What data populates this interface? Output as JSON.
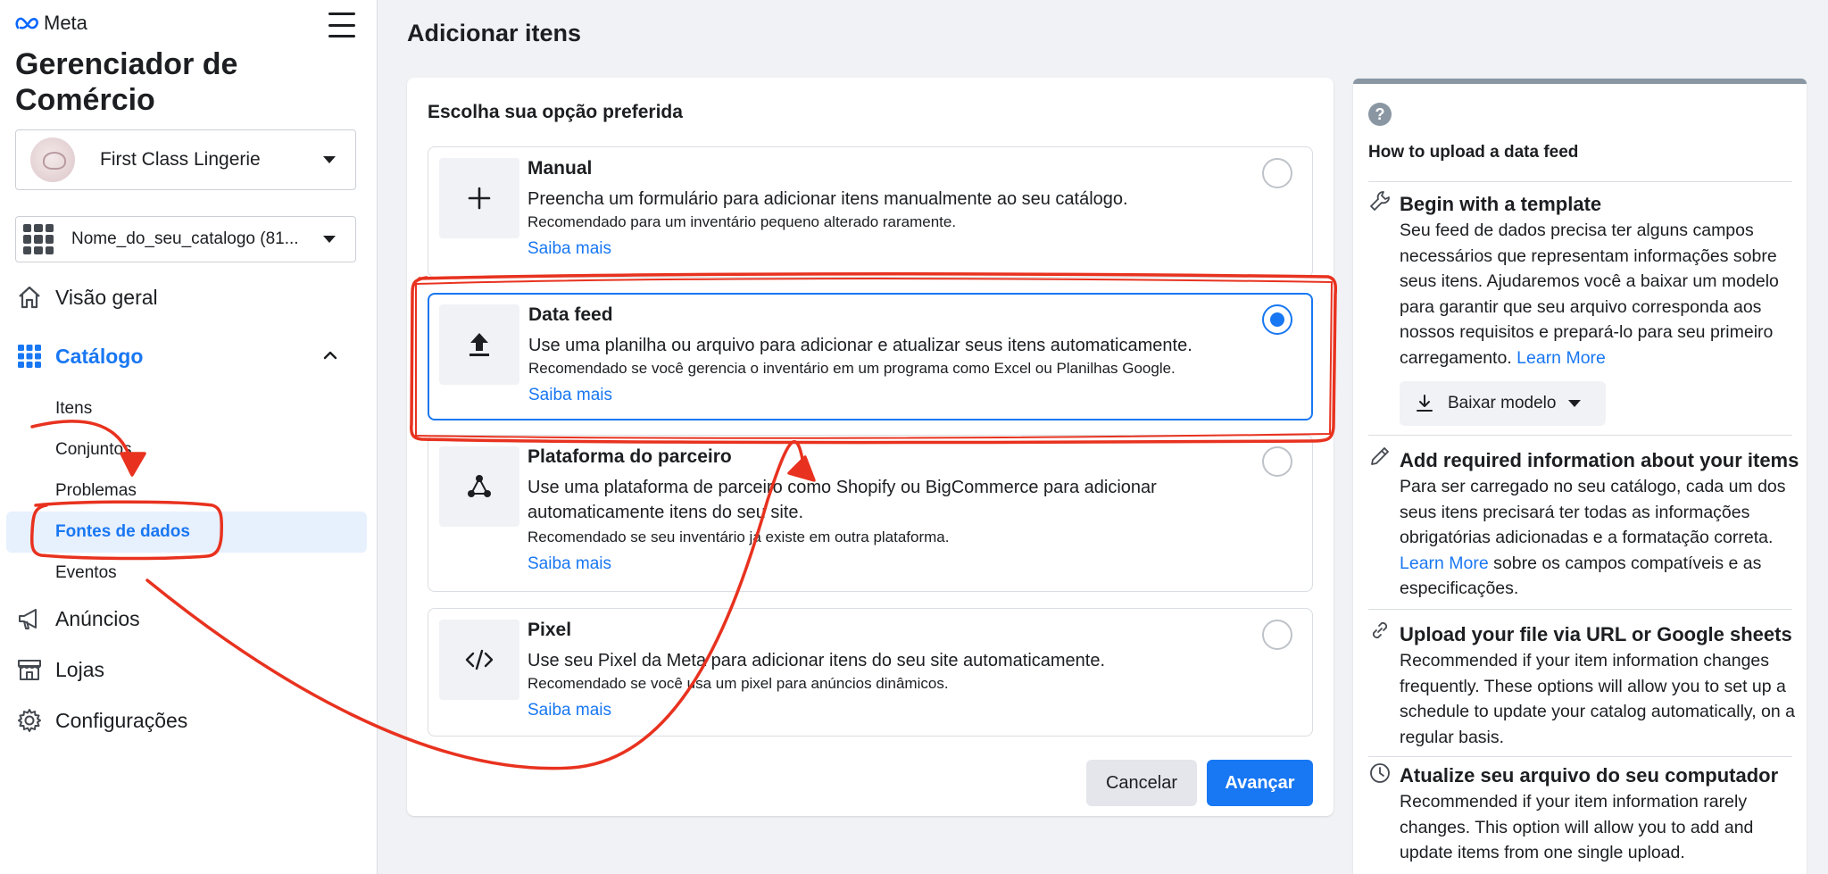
{
  "brand": {
    "name": "Meta",
    "accent": "#1877f2"
  },
  "sidebar": {
    "app_title": "Gerenciador de Comércio",
    "business": "First Class Lingerie",
    "catalog": "Nome_do_seu_catalogo (81...",
    "nav": {
      "overview": "Visão geral",
      "catalog": "Catálogo",
      "ads": "Anúncios",
      "shops": "Lojas",
      "settings": "Configurações"
    },
    "catalog_items": {
      "items": "Itens",
      "sets": "Conjuntos",
      "issues": "Problemas",
      "data_sources": "Fontes de dados",
      "events": "Eventos"
    }
  },
  "main": {
    "page_title": "Adicionar itens",
    "heading": "Escolha sua opção preferida",
    "options": [
      {
        "title": "Manual",
        "desc": "Preencha um formulário para adicionar itens manualmente ao seu catálogo.",
        "rec": "Recomendado para um inventário pequeno alterado raramente.",
        "link": "Saiba mais"
      },
      {
        "title": "Data feed",
        "desc": "Use uma planilha ou arquivo para adicionar e atualizar seus itens automaticamente.",
        "rec": "Recomendado se você gerencia o inventário em um programa como Excel ou Planilhas Google.",
        "link": "Saiba mais"
      },
      {
        "title": "Plataforma do parceiro",
        "desc": "Use uma plataforma de parceiro como Shopify ou BigCommerce para adicionar automaticamente itens do seu site.",
        "rec": "Recomendado se seu inventário já existe em outra plataforma.",
        "link": "Saiba mais"
      },
      {
        "title": "Pixel",
        "desc": "Use seu Pixel da Meta para adicionar itens do seu site automaticamente.",
        "rec": "Recomendado se você usa um pixel para anúncios dinâmicos.",
        "link": "Saiba mais"
      }
    ],
    "selected_option": "Data feed",
    "cancel": "Cancelar",
    "next": "Avançar"
  },
  "help": {
    "q_mark": "?",
    "title": "How to upload a data feed",
    "sections": [
      {
        "title": "Begin with a template",
        "body": "Seu feed de dados precisa ter alguns campos necessários que representam informações sobre seus itens. Ajudaremos você a baixar um modelo para garantir que seu arquivo corresponda aos nossos requisitos e prepará-lo para seu primeiro carregamento.",
        "link": "Learn More"
      },
      {
        "title": "Add required information about your items",
        "body": "Para ser carregado no seu catálogo, cada um dos seus itens precisará ter todas as informações obrigatórias adicionadas e a formatação correta.",
        "link": "Learn More",
        "body_after": "sobre os campos compatíveis e as especificações."
      },
      {
        "title": "Upload your file via URL or Google sheets",
        "body": "Recommended if your item information changes frequently. These options will allow you to set up a schedule to update your catalog automatically, on a regular basis."
      },
      {
        "title": "Atualize seu arquivo do seu computador",
        "body": "Recommended if your item information rarely changes. This option will allow you to add and update items from one single upload."
      }
    ],
    "download_button": "Baixar modelo"
  },
  "annotation_color": "#e8321f"
}
